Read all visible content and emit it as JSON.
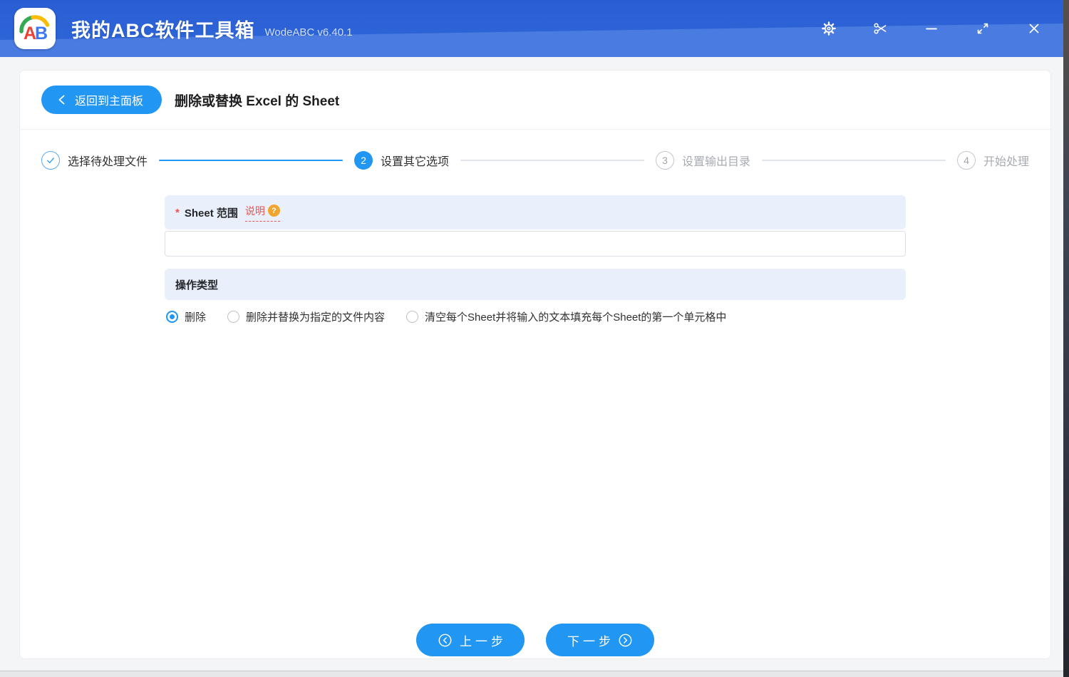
{
  "titlebar": {
    "logo": {
      "letter_a": "A",
      "letter_b": "B"
    },
    "app_title": "我的ABC软件工具箱",
    "version": "WodeABC v6.40.1"
  },
  "header": {
    "back_button": "返回到主面板",
    "page_title": "删除或替换 Excel 的 Sheet"
  },
  "stepper": {
    "steps": [
      {
        "number": "1",
        "label": "选择待处理文件",
        "state": "done"
      },
      {
        "number": "2",
        "label": "设置其它选项",
        "state": "active"
      },
      {
        "number": "3",
        "label": "设置输出目录",
        "state": "pending"
      },
      {
        "number": "4",
        "label": "开始处理",
        "state": "pending"
      }
    ]
  },
  "form": {
    "sheet_range": {
      "required_marker": "*",
      "label": "Sheet 范围",
      "help_text": "说明",
      "help_icon": "?",
      "value": ""
    },
    "operation": {
      "label": "操作类型",
      "options": [
        {
          "label": "删除",
          "selected": true
        },
        {
          "label": "删除并替换为指定的文件内容",
          "selected": false
        },
        {
          "label": "清空每个Sheet并将输入的文本填充每个Sheet的第一个单元格中",
          "selected": false
        }
      ]
    }
  },
  "footer": {
    "prev_button": "上一步",
    "next_button": "下一步"
  },
  "icons": {
    "titlebar": [
      "settings-icon",
      "scissors-icon",
      "minimize-icon",
      "resize-icon",
      "close-icon"
    ]
  },
  "colors": {
    "titlebar_top": "#2B63D8",
    "titlebar_wave": "#4A7BE0",
    "accent_blue": "#2196F3",
    "section_bg": "#E9F0FB",
    "help_red": "#F05050",
    "help_icon_bg": "#F2A52E",
    "logo_a": "#E94335",
    "logo_b": "#3B78F6",
    "logo_arc_green": "#34A853",
    "logo_arc_yellow": "#FBBC05"
  }
}
